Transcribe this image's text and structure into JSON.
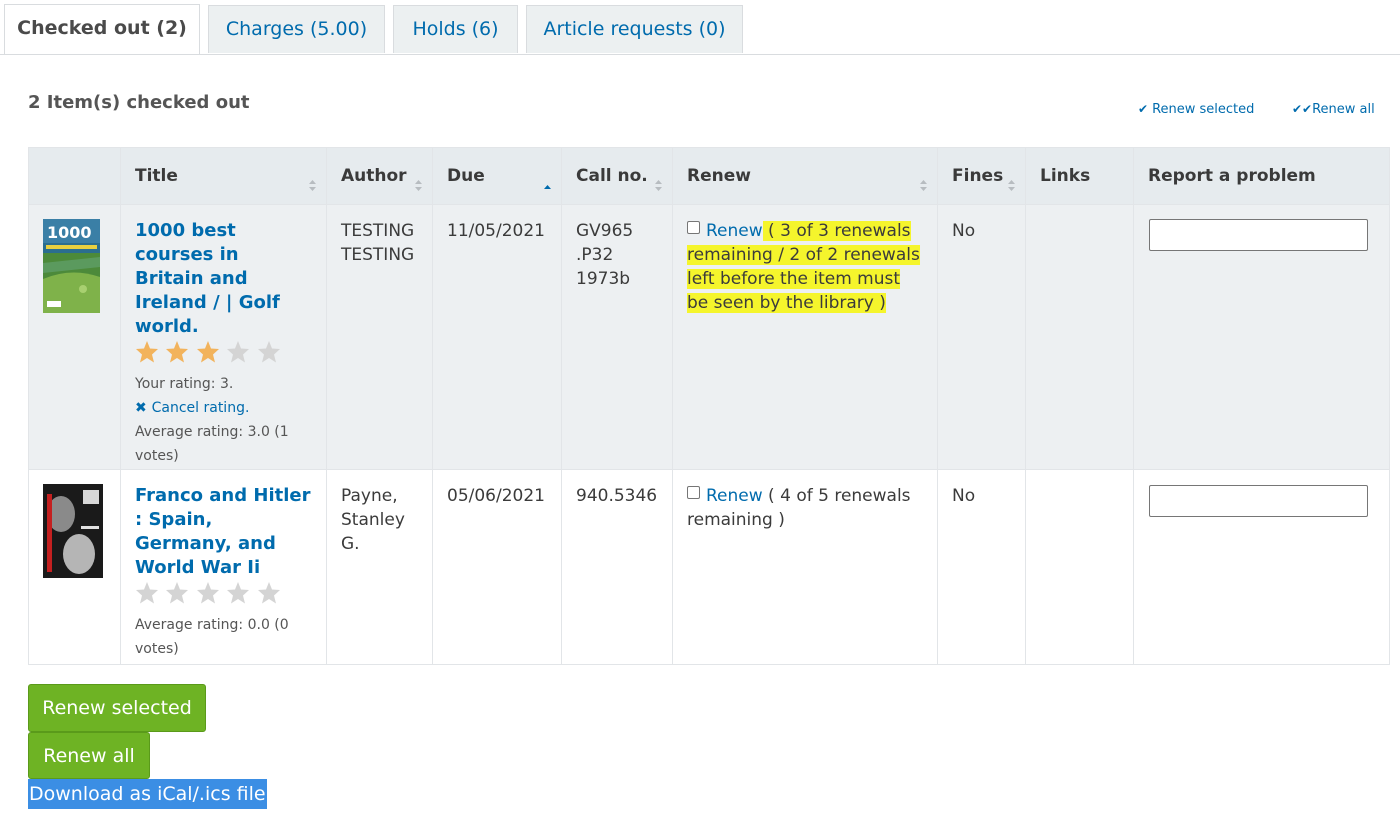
{
  "tabs": [
    {
      "label": "Checked out (2)"
    },
    {
      "label": "Charges (5.00)"
    },
    {
      "label": "Holds (6)"
    },
    {
      "label": "Article requests (0)"
    }
  ],
  "heading": "2 Item(s) checked out",
  "toolbar": {
    "renew_selected": "Renew selected",
    "renew_all": "Renew all",
    "check_icon": "check-icon",
    "double_check_icon": "double-check-icon"
  },
  "columns": [
    "Title",
    "Author",
    "Due",
    "Call no.",
    "Renew",
    "Fines",
    "Links",
    "Report a problem"
  ],
  "sort": {
    "Title": "sortable",
    "Author": "sortable",
    "Due": "ascending",
    "Call no.": "sortable",
    "Renew": "sortable",
    "Fines": "sortable"
  },
  "items": [
    {
      "cover_icon": "book-cover-golf",
      "title": "1000 best courses in Britain and Ireland / | Golf world.",
      "rating": 3,
      "your_rating": "Your rating: 3.",
      "cancel_rating": "Cancel rating.",
      "average": "Average rating: 3.0 (1 votes)",
      "author": "TESTING TESTING",
      "due": "11/05/2021",
      "callno": "GV965 .P32 1973b",
      "renew_label": "Renew",
      "renew_info": " ( 3 of 3 renewals remaining / 2 of 2 renewals left before the item must be seen by the library )",
      "renew_highlighted": true,
      "fines": "No",
      "links": ""
    },
    {
      "cover_icon": "book-cover-franco",
      "title": "Franco and Hitler : Spain, Germany, and World War Ii",
      "rating": 0,
      "average": "Average rating: 0.0 (0 votes)",
      "author": "Payne, Stanley G.",
      "due": "05/06/2021",
      "callno": "940.5346",
      "renew_label": "Renew",
      "renew_info": " ( 4 of 5 renewals remaining )",
      "renew_highlighted": false,
      "fines": "No",
      "links": ""
    }
  ],
  "buttons": {
    "renew_selected": "Renew selected",
    "renew_all": "Renew all"
  },
  "download": "Download as iCal/.ics file",
  "colors": {
    "link": "#006bad",
    "button": "#6eb324",
    "highlight": "#f5f52c",
    "selection": "#3b8ee4",
    "star_filled": "#f2b35c",
    "star_empty": "#d4d4d4"
  }
}
